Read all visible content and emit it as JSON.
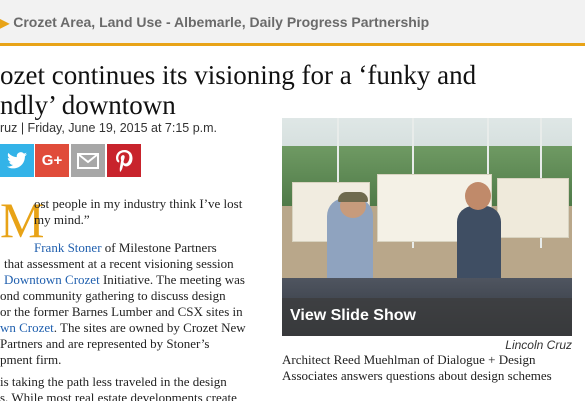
{
  "breadcrumb": "Crozet Area, Land Use - Albemarle, Daily Progress Partnership",
  "headline": {
    "line1": "ozet continues its visioning for a ‘funky and",
    "line2": "ndly’ downtown"
  },
  "byline": "ruz | Friday, June 19, 2015 at 7:15 p.m.",
  "share": {
    "twitter": "twitter-icon",
    "googleplus": "G+",
    "email": "email-icon",
    "pinterest": "pinterest-icon"
  },
  "article": {
    "dropcap": "M",
    "quote_line1": "ost people in my industry think I’ve lost",
    "quote_line2": "my mind.”",
    "link_stoner": "Frank Stoner",
    "after_stoner": " of Milestone Partners",
    "line4": "that assessment at a recent visioning session",
    "link_downtown": "Downtown Crozet",
    "after_downtown": " Initiative. The meeting was",
    "line6": "ond community gathering to discuss design",
    "line7": "or the former Barnes Lumber and CSX sites in",
    "link_crozet": "wn Crozet",
    "after_crozet": ". The sites are owned by Crozet New",
    "line9": "Partners and are represented by Stoner’s",
    "line10": "pment firm.",
    "line11": "is taking the path less traveled in the design",
    "line12": "s. While most real estate developments create"
  },
  "photo": {
    "slide_label": "View Slide Show",
    "credit": "Lincoln Cruz",
    "caption": "Architect Reed Muehlman of Dialogue + Design Associates answers questions about design schemes"
  },
  "colors": {
    "accent": "#e8a317",
    "link": "#1f5fae",
    "twitter": "#33b3e8",
    "googleplus": "#e04c3a",
    "email": "#a7a7a7",
    "pinterest": "#c8232c"
  }
}
